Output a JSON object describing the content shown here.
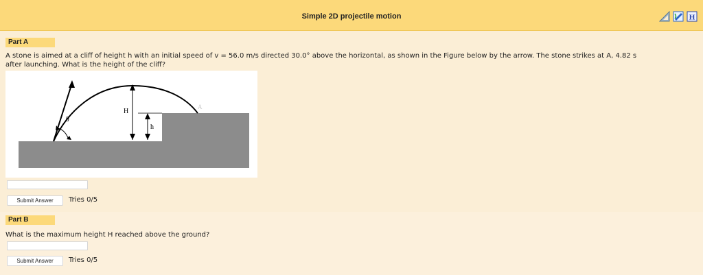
{
  "header": {
    "title": "Simple 2D projectile motion",
    "icons": [
      "triangle-ruler-icon",
      "sketch-pencil-icon",
      "hint-h-icon"
    ]
  },
  "partA": {
    "label": "Part A",
    "question_line1": "A stone is aimed at a cliff of height h with an initial speed of v = 56.0 m/s directed 30.0° above the horizontal, as shown in the Figure below by the arrow. The stone strikes at A, 4.82 s",
    "question_line2": "after launching. What is the height of the cliff?",
    "answer_value": "",
    "submit_label": "Submit Answer",
    "tries": "Tries 0/5"
  },
  "figure": {
    "label_H": "H",
    "label_h": "h",
    "label_theta": "θ",
    "label_A": "A"
  },
  "partB": {
    "label": "Part B",
    "question": "What is the maximum height H reached above the ground?",
    "answer_value": "",
    "submit_label": "Submit Answer",
    "tries": "Tries 0/5"
  },
  "colors": {
    "header_bg": "#fcd97a",
    "page_bg": "#fbeed6",
    "ground": "#8c8c8c"
  }
}
